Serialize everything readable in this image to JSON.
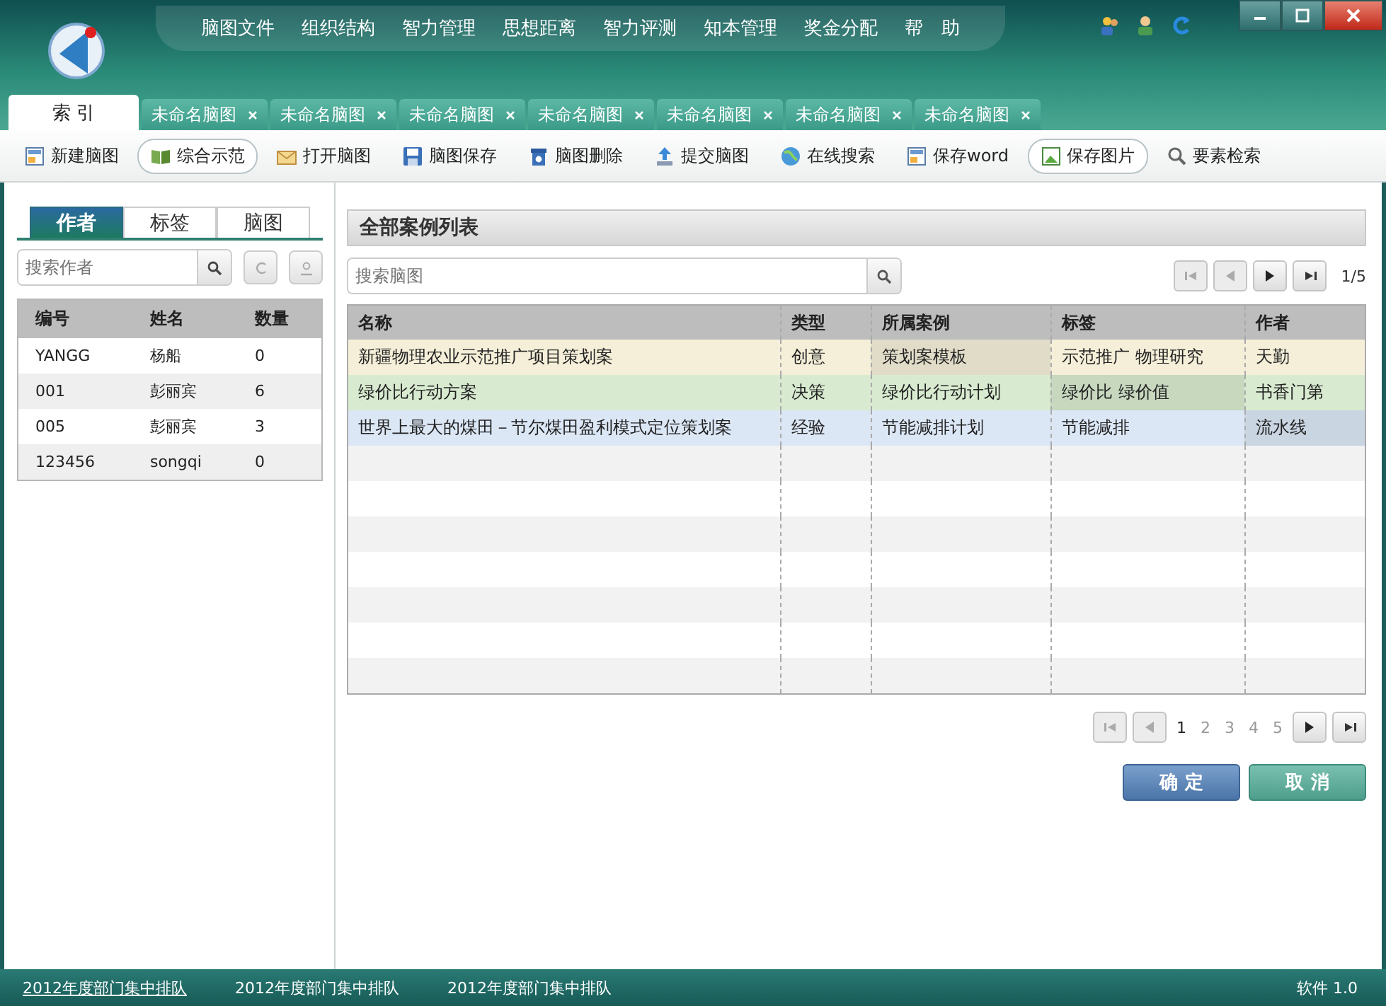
{
  "menu": [
    "脑图文件",
    "组织结构",
    "智力管理",
    "思想距离",
    "智力评测",
    "知本管理",
    "奖金分配",
    "帮　助"
  ],
  "tabs": [
    {
      "label": "索 引",
      "selected": true,
      "closable": false
    },
    {
      "label": "未命名脑图",
      "selected": false,
      "closable": true
    },
    {
      "label": "未命名脑图",
      "selected": false,
      "closable": true
    },
    {
      "label": "未命名脑图",
      "selected": false,
      "closable": true
    },
    {
      "label": "未命名脑图",
      "selected": false,
      "closable": true
    },
    {
      "label": "未命名脑图",
      "selected": false,
      "closable": true
    },
    {
      "label": "未命名脑图",
      "selected": false,
      "closable": true
    },
    {
      "label": "未命名脑图",
      "selected": false,
      "closable": true
    }
  ],
  "toolbar": [
    {
      "label": "新建脑图",
      "kind": "document",
      "selected": false
    },
    {
      "label": "综合示范",
      "kind": "book",
      "selected": true
    },
    {
      "label": "打开脑图",
      "kind": "envelope",
      "selected": false
    },
    {
      "label": "脑图保存",
      "kind": "disk",
      "selected": false
    },
    {
      "label": "脑图删除",
      "kind": "trash",
      "selected": false
    },
    {
      "label": "提交脑图",
      "kind": "upload",
      "selected": false
    },
    {
      "label": "在线搜索",
      "kind": "globe",
      "selected": false
    },
    {
      "label": "保存word",
      "kind": "document",
      "selected": false
    },
    {
      "label": "保存图片",
      "kind": "picture",
      "selected": true
    },
    {
      "label": "要素检索",
      "kind": "search",
      "selected": false
    }
  ],
  "sidebar": {
    "tabs": [
      {
        "label": "作者",
        "selected": true
      },
      {
        "label": "标签",
        "selected": false
      },
      {
        "label": "脑图",
        "selected": false
      }
    ],
    "search": {
      "placeholder": "搜索作者"
    },
    "columns": [
      "编号",
      "姓名",
      "数量"
    ],
    "rows": [
      [
        "YANGG",
        "杨船",
        "0"
      ],
      [
        "001",
        "彭丽宾",
        "6"
      ],
      [
        "005",
        "彭丽宾",
        "3"
      ],
      [
        "123456",
        "songqi",
        "0"
      ]
    ]
  },
  "panel": {
    "title": "全部案例列表",
    "search": {
      "placeholder": "搜索脑图"
    },
    "page_indicator": "1/5",
    "columns": [
      "名称",
      "类型",
      "所属案例",
      "标签",
      "作者"
    ],
    "rows": [
      {
        "color": "#f5efd9",
        "cells": [
          {
            "text": "新疆物理农业示范推广项目策划案",
            "highlighted": false
          },
          {
            "text": "创意",
            "highlighted": false
          },
          {
            "text": "策划案模板",
            "highlighted": true
          },
          {
            "text": "示范推广  物理研究",
            "highlighted": false
          },
          {
            "text": "天勤",
            "highlighted": false
          }
        ]
      },
      {
        "color": "#d8ebd0",
        "cells": [
          {
            "text": "绿价比行动方案",
            "highlighted": false
          },
          {
            "text": "决策",
            "highlighted": false
          },
          {
            "text": "绿价比行动计划",
            "highlighted": false
          },
          {
            "text": "绿价比  绿价值",
            "highlighted": true
          },
          {
            "text": "书香门第",
            "highlighted": false
          }
        ]
      },
      {
        "color": "#dce7f6",
        "cells": [
          {
            "text": "世界上最大的煤田－节尔煤田盈利模式定位策划案",
            "highlighted": false
          },
          {
            "text": "经验",
            "highlighted": false
          },
          {
            "text": "节能减排计划",
            "highlighted": false
          },
          {
            "text": "节能减排",
            "highlighted": false
          },
          {
            "text": "流水线",
            "highlighted": true
          }
        ]
      }
    ],
    "pages": [
      {
        "label": "1",
        "selected": true
      },
      {
        "label": "2",
        "selected": false
      },
      {
        "label": "3",
        "selected": false
      },
      {
        "label": "4",
        "selected": false
      },
      {
        "label": "5",
        "selected": false
      }
    ],
    "buttons": [
      {
        "label": "确 定",
        "kind": "primary"
      },
      {
        "label": "取 消",
        "kind": "secondary"
      }
    ]
  },
  "status_bar": {
    "links": [
      "2012年度部门集中排队",
      "2012年度部门集中排队",
      "2012年度部门集中排队"
    ],
    "version": "软件 1.0"
  }
}
